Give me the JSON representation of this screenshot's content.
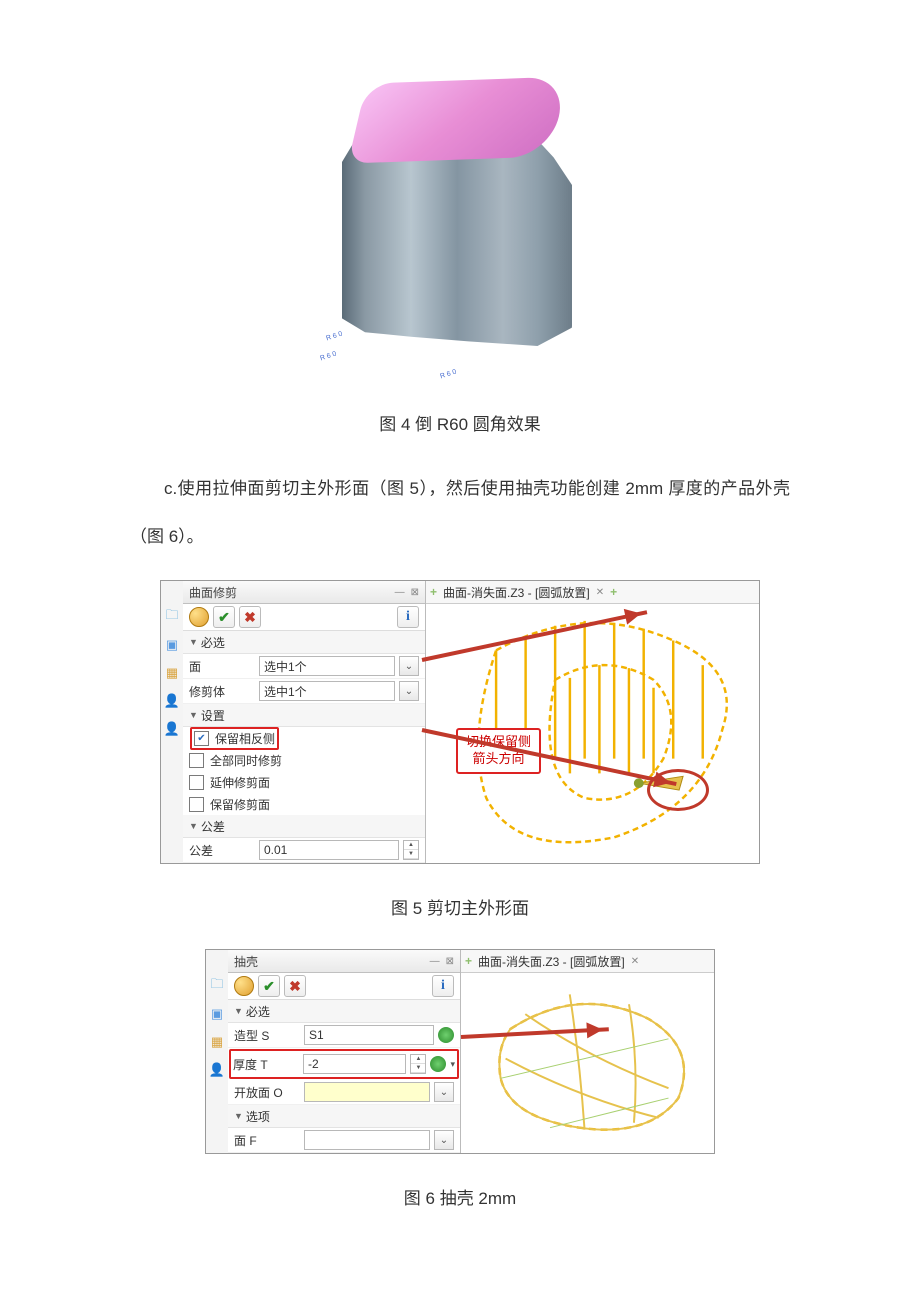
{
  "caption4": "图 4 倒 R60 圆角效果",
  "body_c": "c.使用拉伸面剪切主外形面（图 5），然后使用抽壳功能创建 2mm 厚度的产品外壳（图 6）。",
  "caption5": "图 5 剪切主外形面",
  "caption6": "图 6 抽壳 2mm",
  "sketch_labels": [
    "R 6 0",
    "R 6 0",
    "R 6 0"
  ],
  "fig5": {
    "panel_title": "曲面修剪",
    "section_required": "必选",
    "section_settings": "设置",
    "section_tolerance": "公差",
    "field_face": "面",
    "field_face_val": "选中1个",
    "field_trim": "修剪体",
    "field_trim_val": "选中1个",
    "chk_keep_opposite": "保留相反侧",
    "chk_trim_all": "全部同时修剪",
    "chk_extend": "延伸修剪面",
    "chk_keep_trim": "保留修剪面",
    "tol_label": "公差",
    "tol_val": "0.01",
    "annotation": "切换保留侧\n箭头方向",
    "tab": "曲面-消失面.Z3 - [圆弧放置]"
  },
  "fig6": {
    "panel_title": "抽壳",
    "section_required": "必选",
    "section_options": "选项",
    "field_shape": "造型 S",
    "field_shape_val": "S1",
    "field_thick": "厚度 T",
    "field_thick_val": "-2",
    "field_open": "开放面 O",
    "field_open_val": "",
    "field_face": "面 F",
    "tab": "曲面-消失面.Z3 - [圆弧放置]"
  }
}
